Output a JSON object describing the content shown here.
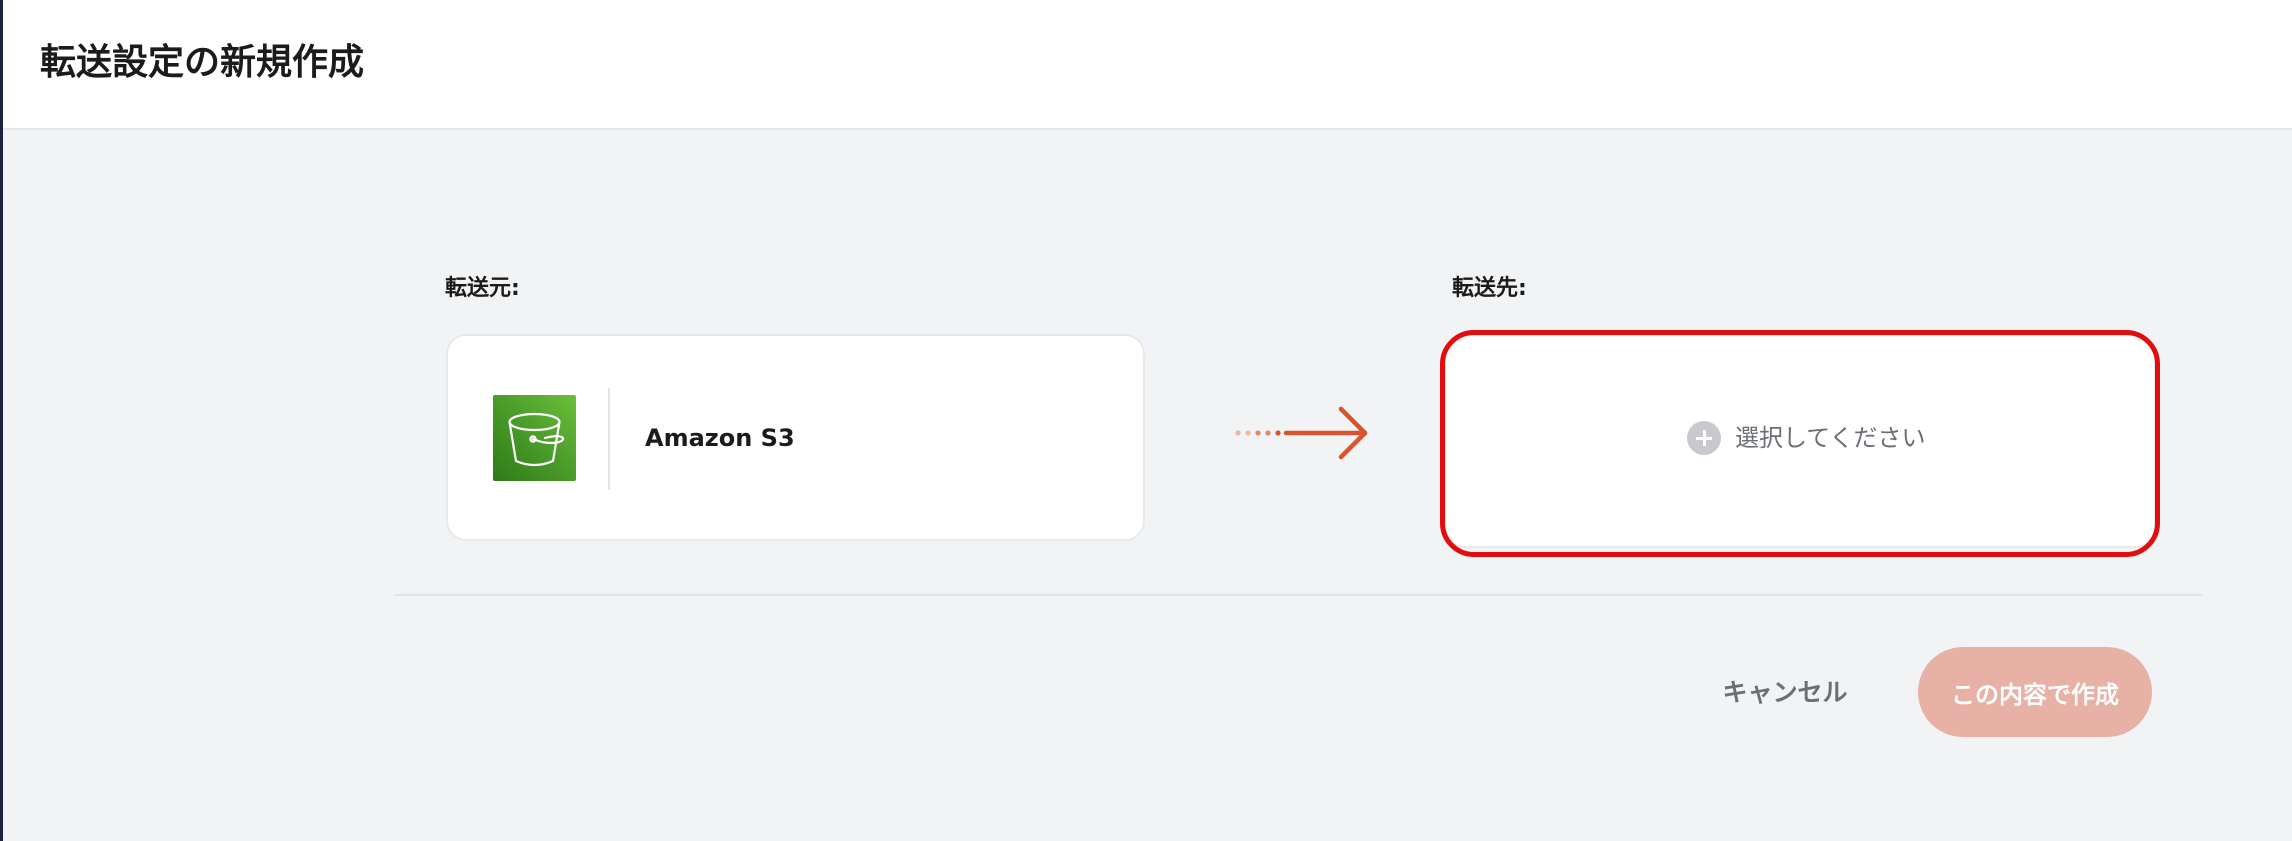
{
  "page": {
    "title": "転送設定の新規作成"
  },
  "source": {
    "label": "転送元:",
    "name": "Amazon S3",
    "icon": "s3-bucket-icon",
    "icon_color": "#3f8624"
  },
  "flow": {
    "icon": "arrow-right-icon",
    "color": "#d9542c"
  },
  "destination": {
    "label": "転送先:",
    "select_text": "選択してください",
    "icon": "plus-circle-icon",
    "highlight_color": "#e20d0d"
  },
  "actions": {
    "cancel_label": "キャンセル",
    "create_label": "この内容で作成",
    "create_color": "#e8b1a6"
  }
}
